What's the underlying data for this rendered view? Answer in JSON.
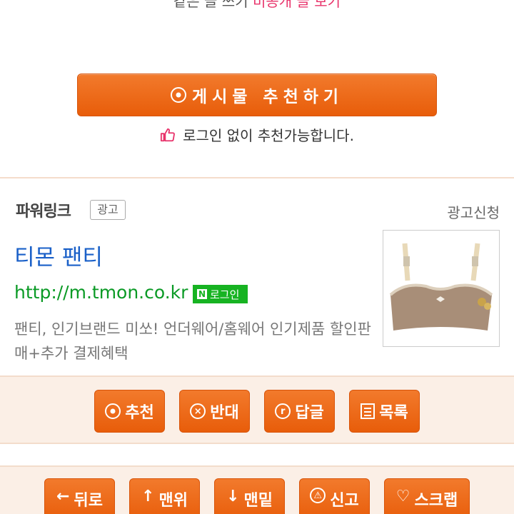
{
  "top_partial": {
    "text_left": "같은 글 쓰기 ",
    "text_highlight": "비공개 글 보기"
  },
  "recommend": {
    "label": "게시물 추천하기",
    "note": "로그인 없이 추천가능합니다."
  },
  "powerlink": {
    "title": "파워링크",
    "ad_badge": "광고",
    "ad_request": "광고신청",
    "ad": {
      "title": "티몬 팬티",
      "url": "http://m.tmon.co.kr",
      "npay_badge": "로그인",
      "npay_n": "N",
      "description": "팬티, 인기브랜드 미쏘! 언더웨어/홈웨어 인기제품 할인판매+추가 결제혜택"
    }
  },
  "actions": [
    {
      "label": "추천",
      "icon": "circle-dot-icon"
    },
    {
      "label": "반대",
      "icon": "circle-x-icon"
    },
    {
      "label": "답글",
      "icon": "circle-r-icon"
    },
    {
      "label": "목록",
      "icon": "list-icon"
    }
  ],
  "nav": [
    {
      "label": "뒤로",
      "icon": "arrow-left-icon"
    },
    {
      "label": "맨위",
      "icon": "arrow-up-icon"
    },
    {
      "label": "맨밑",
      "icon": "arrow-down-icon"
    },
    {
      "label": "신고",
      "icon": "report-icon"
    },
    {
      "label": "스크랩",
      "icon": "heart-icon"
    }
  ],
  "colors": {
    "accent": "#e85d0a",
    "link_blue": "#1a60c8",
    "url_green": "#0a9a25",
    "npay_green": "#17b322",
    "thumb_red": "#e8336b"
  }
}
